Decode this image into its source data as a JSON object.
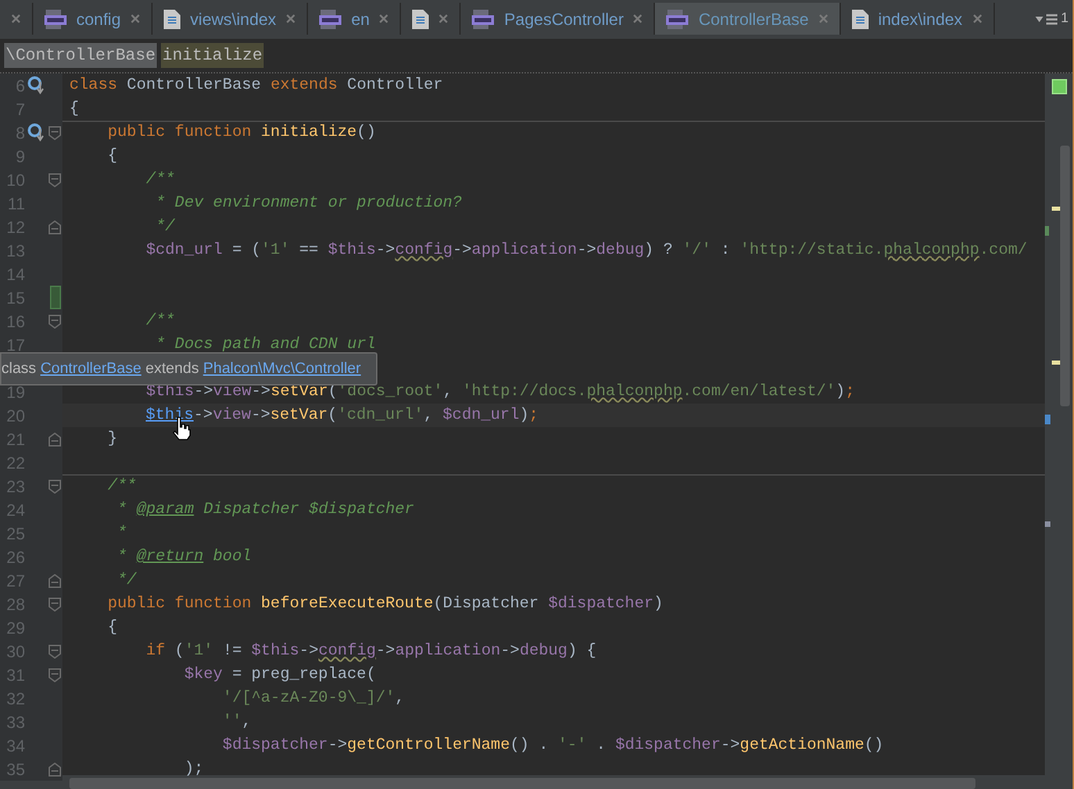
{
  "tabs": [
    {
      "kind": "blank",
      "selected": false
    },
    {
      "label": "config",
      "kind": "php",
      "selected": false
    },
    {
      "label": "views\\index",
      "kind": "file",
      "selected": false
    },
    {
      "label": "en",
      "kind": "php",
      "selected": false
    },
    {
      "kind": "file",
      "selected": false
    },
    {
      "label": "PagesController",
      "kind": "php",
      "selected": false
    },
    {
      "label": "ControllerBase",
      "kind": "php",
      "selected": true
    },
    {
      "label": "index\\index",
      "kind": "file",
      "selected": false
    }
  ],
  "overflow_count": "1",
  "breadcrumbs": [
    {
      "text": "\\ControllerBase",
      "selected": false
    },
    {
      "text": "initialize",
      "selected": true
    }
  ],
  "lines": [
    {
      "kind": "code",
      "number": "6",
      "override": true,
      "tokens": [
        {
          "kind": "keyword",
          "text": "class "
        },
        {
          "kind": "plain",
          "text": "ControllerBase "
        },
        {
          "kind": "keyword",
          "text": "extends "
        },
        {
          "kind": "plain",
          "text": "Controller"
        }
      ]
    },
    {
      "kind": "code",
      "number": "7",
      "tokens": [
        {
          "kind": "plain",
          "text": "{"
        }
      ]
    },
    {
      "kind": "code",
      "number": "8",
      "override": true,
      "fold_start": true,
      "separator": true,
      "tokens": [
        {
          "kind": "keyword",
          "text": "    public function "
        },
        {
          "kind": "function",
          "text": "initialize"
        },
        {
          "kind": "plain",
          "text": "()"
        }
      ]
    },
    {
      "kind": "code",
      "number": "9",
      "tokens": [
        {
          "kind": "plain",
          "text": "    {"
        }
      ]
    },
    {
      "kind": "code",
      "number": "10",
      "fold_start": true,
      "tokens": [
        {
          "kind": "comment",
          "text": "        /**"
        }
      ]
    },
    {
      "kind": "code",
      "number": "11",
      "tokens": [
        {
          "kind": "comment",
          "text": "         * Dev environment or production?"
        }
      ]
    },
    {
      "kind": "code",
      "number": "12",
      "fold_end": true,
      "tokens": [
        {
          "kind": "comment",
          "text": "         */"
        }
      ]
    },
    {
      "kind": "code",
      "number": "13",
      "tokens": [
        {
          "kind": "variable",
          "text": "        $cdn_url"
        },
        {
          "kind": "plain",
          "text": " = ("
        },
        {
          "kind": "string",
          "text": "'1'"
        },
        {
          "kind": "plain",
          "text": " == "
        },
        {
          "kind": "variable",
          "text": "$this"
        },
        {
          "kind": "plain",
          "text": "->"
        },
        {
          "kind": "variable_typo",
          "text": "config"
        },
        {
          "kind": "plain",
          "text": "->"
        },
        {
          "kind": "variable",
          "text": "application"
        },
        {
          "kind": "plain",
          "text": "->"
        },
        {
          "kind": "variable",
          "text": "debug"
        },
        {
          "kind": "plain",
          "text": ") ? "
        },
        {
          "kind": "string",
          "text": "'/'"
        },
        {
          "kind": "plain",
          "text": " : "
        },
        {
          "kind": "string",
          "text": "'http://static."
        },
        {
          "kind": "string_typo",
          "text": "phalconphp"
        },
        {
          "kind": "string",
          "text": ".com/"
        }
      ]
    },
    {
      "kind": "code",
      "number": "14"
    },
    {
      "kind": "code",
      "number": "15",
      "changed": true
    },
    {
      "kind": "code",
      "number": "16",
      "fold_start": true,
      "tokens": [
        {
          "kind": "comment",
          "text": "        /**"
        }
      ]
    },
    {
      "kind": "code",
      "number": "17",
      "tokens": [
        {
          "kind": "comment",
          "text": "         * Docs path and CDN url"
        }
      ]
    },
    {
      "kind": "tooltip",
      "parts": [
        {
          "kind": "plain",
          "text": "class"
        },
        {
          "kind": "link",
          "text": "ControllerBase"
        },
        {
          "kind": "plain",
          "text": "extends"
        },
        {
          "kind": "link",
          "text": "Phalcon\\Mvc\\Controller"
        }
      ]
    },
    {
      "kind": "code",
      "number": "19",
      "tokens": [
        {
          "kind": "variable",
          "text": "        $this"
        },
        {
          "kind": "plain",
          "text": "->"
        },
        {
          "kind": "variable",
          "text": "view"
        },
        {
          "kind": "plain",
          "text": "->"
        },
        {
          "kind": "function",
          "text": "setVar"
        },
        {
          "kind": "plain",
          "text": "("
        },
        {
          "kind": "string",
          "text": "'docs_root'"
        },
        {
          "kind": "plain",
          "text": ", "
        },
        {
          "kind": "string",
          "text": "'http://docs."
        },
        {
          "kind": "string_typo",
          "text": "phalconphp"
        },
        {
          "kind": "string",
          "text": ".com/en/latest/'"
        },
        {
          "kind": "plain",
          "text": ")"
        },
        {
          "kind": "keyword",
          "text": ";"
        }
      ]
    },
    {
      "kind": "code",
      "number": "20",
      "current": true,
      "tokens": [
        {
          "kind": "link",
          "text": "$this"
        },
        {
          "kind": "plain",
          "text": "->"
        },
        {
          "kind": "variable",
          "text": "view"
        },
        {
          "kind": "plain",
          "text": "->"
        },
        {
          "kind": "function",
          "text": "setVar"
        },
        {
          "kind": "plain",
          "text": "("
        },
        {
          "kind": "string",
          "text": "'cdn_url'"
        },
        {
          "kind": "plain",
          "text": ", "
        },
        {
          "kind": "variable",
          "text": "$cdn_url"
        },
        {
          "kind": "plain",
          "text": ")"
        },
        {
          "kind": "keyword",
          "text": ";"
        }
      ]
    },
    {
      "kind": "code",
      "number": "21",
      "fold_end": true,
      "tokens": [
        {
          "kind": "plain",
          "text": "    }"
        }
      ]
    },
    {
      "kind": "code",
      "number": "22"
    },
    {
      "kind": "code",
      "number": "23",
      "fold_start": true,
      "separator": true,
      "tokens": [
        {
          "kind": "comment",
          "text": "    /**"
        }
      ]
    },
    {
      "kind": "code",
      "number": "24",
      "tokens": [
        {
          "kind": "comment",
          "text": "     * "
        },
        {
          "kind": "doc_tag",
          "text": "@param"
        },
        {
          "kind": "comment",
          "text": " Dispatcher $dispatcher"
        }
      ]
    },
    {
      "kind": "code",
      "number": "25",
      "tokens": [
        {
          "kind": "comment",
          "text": "     *"
        }
      ]
    },
    {
      "kind": "code",
      "number": "26",
      "tokens": [
        {
          "kind": "comment",
          "text": "     * "
        },
        {
          "kind": "doc_tag",
          "text": "@return"
        },
        {
          "kind": "comment",
          "text": " bool"
        }
      ]
    },
    {
      "kind": "code",
      "number": "27",
      "fold_end": true,
      "tokens": [
        {
          "kind": "comment",
          "text": "     */"
        }
      ]
    },
    {
      "kind": "code",
      "number": "28",
      "fold_start": true,
      "tokens": [
        {
          "kind": "keyword",
          "text": "    public function "
        },
        {
          "kind": "function",
          "text": "beforeExecuteRoute"
        },
        {
          "kind": "plain",
          "text": "(Dispatcher "
        },
        {
          "kind": "variable",
          "text": "$dispatcher"
        },
        {
          "kind": "plain",
          "text": ")"
        }
      ]
    },
    {
      "kind": "code",
      "number": "29",
      "tokens": [
        {
          "kind": "plain",
          "text": "    {"
        }
      ]
    },
    {
      "kind": "code",
      "number": "30",
      "fold_start": true,
      "tokens": [
        {
          "kind": "keyword",
          "text": "        if "
        },
        {
          "kind": "plain",
          "text": "("
        },
        {
          "kind": "string",
          "text": "'1'"
        },
        {
          "kind": "plain",
          "text": " != "
        },
        {
          "kind": "variable",
          "text": "$this"
        },
        {
          "kind": "plain",
          "text": "->"
        },
        {
          "kind": "variable_typo",
          "text": "config"
        },
        {
          "kind": "plain",
          "text": "->"
        },
        {
          "kind": "variable",
          "text": "application"
        },
        {
          "kind": "plain",
          "text": "->"
        },
        {
          "kind": "variable",
          "text": "debug"
        },
        {
          "kind": "plain",
          "text": ") {"
        }
      ]
    },
    {
      "kind": "code",
      "number": "31",
      "fold_start": true,
      "tokens": [
        {
          "kind": "variable",
          "text": "            $key"
        },
        {
          "kind": "plain",
          "text": " = preg_replace("
        }
      ]
    },
    {
      "kind": "code",
      "number": "32",
      "tokens": [
        {
          "kind": "string",
          "text": "                '/[^a-zA-Z0-9\\_]/'"
        },
        {
          "kind": "plain",
          "text": ","
        }
      ]
    },
    {
      "kind": "code",
      "number": "33",
      "tokens": [
        {
          "kind": "string",
          "text": "                ''"
        },
        {
          "kind": "plain",
          "text": ","
        }
      ]
    },
    {
      "kind": "code",
      "number": "34",
      "tokens": [
        {
          "kind": "variable",
          "text": "                $dispatcher"
        },
        {
          "kind": "plain",
          "text": "->"
        },
        {
          "kind": "function",
          "text": "getControllerName"
        },
        {
          "kind": "plain",
          "text": "() . "
        },
        {
          "kind": "string",
          "text": "'-'"
        },
        {
          "kind": "plain",
          "text": " . "
        },
        {
          "kind": "variable",
          "text": "$dispatcher"
        },
        {
          "kind": "plain",
          "text": "->"
        },
        {
          "kind": "function",
          "text": "getActionName"
        },
        {
          "kind": "plain",
          "text": "()"
        }
      ]
    },
    {
      "kind": "code",
      "number": "35",
      "fold_end": true,
      "tokens": [
        {
          "kind": "plain",
          "text": "            );"
        }
      ]
    }
  ]
}
